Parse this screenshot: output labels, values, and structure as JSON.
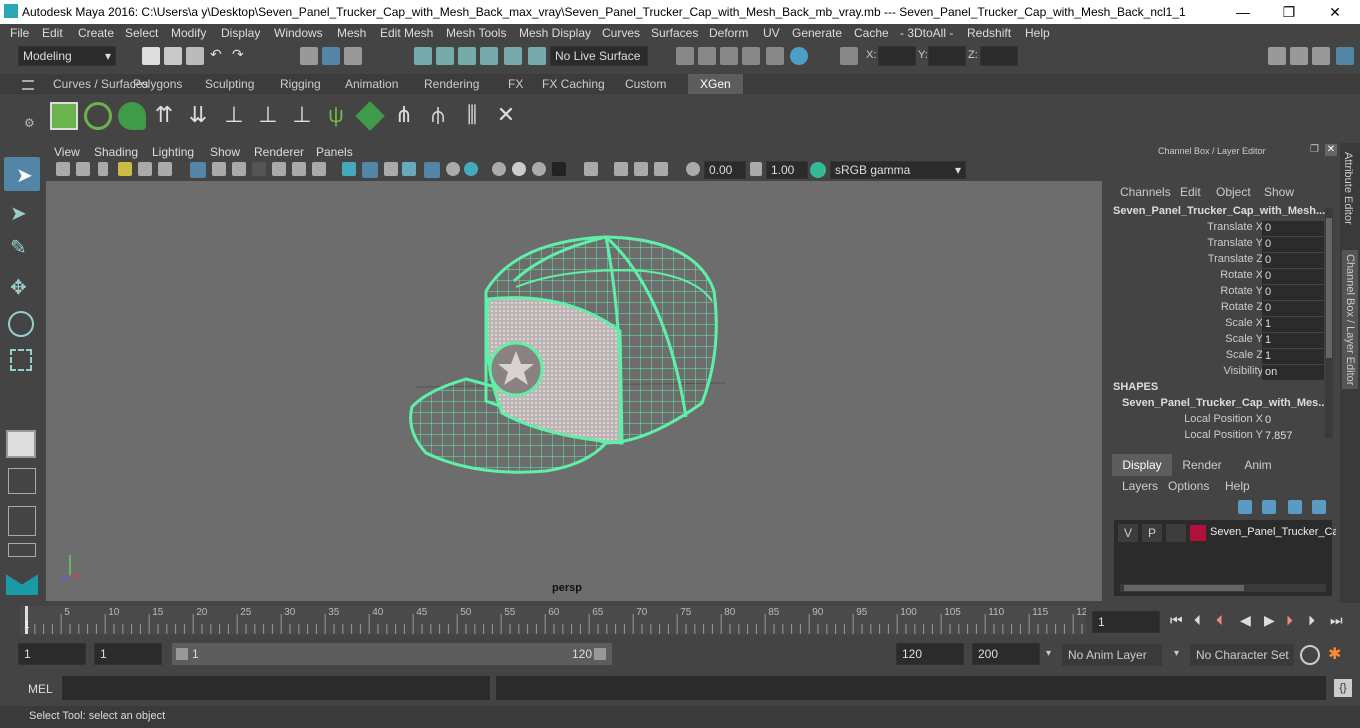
{
  "window": {
    "title": "Autodesk Maya 2016: C:\\Users\\a y\\Desktop\\Seven_Panel_Trucker_Cap_with_Mesh_Back_max_vray\\Seven_Panel_Trucker_Cap_with_Mesh_Back_mb_vray.mb   ---   Seven_Panel_Trucker_Cap_with_Mesh_Back_ncl1_1",
    "min": "—",
    "max": "❐",
    "close": "✕"
  },
  "menu": [
    "File",
    "Edit",
    "Create",
    "Select",
    "Modify",
    "Display",
    "Windows",
    "Mesh",
    "Edit Mesh",
    "Mesh Tools",
    "Mesh Display",
    "Curves",
    "Surfaces",
    "Deform",
    "UV",
    "Generate",
    "Cache",
    "- 3DtoAll -",
    "Redshift",
    "Help"
  ],
  "status": {
    "mode": "Modeling",
    "live_surface": "No Live Surface",
    "x_label": "X:",
    "y_label": "Y:",
    "z_label": "Z:"
  },
  "shelf_tabs": [
    "Curves / Surfaces",
    "Polygons",
    "Sculpting",
    "Rigging",
    "Animation",
    "Rendering",
    "FX",
    "FX Caching",
    "Custom",
    "XGen"
  ],
  "shelf_active": "XGen",
  "viewport": {
    "menu": [
      "View",
      "Shading",
      "Lighting",
      "Show",
      "Renderer",
      "Panels"
    ],
    "exposure": "0.00",
    "gamma": "1.00",
    "colorspace": "sRGB gamma",
    "camera": "persp"
  },
  "channel_box": {
    "header": "Channel Box / Layer Editor",
    "menu": [
      "Channels",
      "Edit",
      "Object",
      "Show"
    ],
    "object": "Seven_Panel_Trucker_Cap_with_Mesh...",
    "channels": [
      {
        "label": "Translate X",
        "value": "0"
      },
      {
        "label": "Translate Y",
        "value": "0"
      },
      {
        "label": "Translate Z",
        "value": "0"
      },
      {
        "label": "Rotate X",
        "value": "0"
      },
      {
        "label": "Rotate Y",
        "value": "0"
      },
      {
        "label": "Rotate Z",
        "value": "0"
      },
      {
        "label": "Scale X",
        "value": "1"
      },
      {
        "label": "Scale Y",
        "value": "1"
      },
      {
        "label": "Scale Z",
        "value": "1"
      },
      {
        "label": "Visibility",
        "value": "on"
      }
    ],
    "shapes_label": "SHAPES",
    "shape_name": "Seven_Panel_Trucker_Cap_with_Mes...",
    "shape_channels": [
      {
        "label": "Local Position X",
        "value": "0"
      },
      {
        "label": "Local Position Y",
        "value": "7.857"
      }
    ]
  },
  "layer_editor": {
    "tabs": [
      "Display",
      "Render",
      "Anim"
    ],
    "menu": [
      "Layers",
      "Options",
      "Help"
    ],
    "layer": {
      "v": "V",
      "p": "P",
      "name": "Seven_Panel_Trucker_Cap",
      "color": "#b0103a"
    }
  },
  "side_tabs": [
    "Attribute Editor",
    "Channel Box / Layer Editor"
  ],
  "timeline": {
    "ticks": [
      "5",
      "10",
      "15",
      "20",
      "25",
      "30",
      "35",
      "40",
      "45",
      "50",
      "55",
      "60",
      "65",
      "70",
      "75",
      "80",
      "85",
      "90",
      "95",
      "100",
      "105",
      "110",
      "115",
      "12"
    ],
    "start_marker": "1",
    "current_frame": "1"
  },
  "range": {
    "start": "1",
    "play_start": "1",
    "slider_start": "1",
    "slider_end": "120",
    "play_end": "120",
    "end": "200",
    "anim_layer": "No Anim Layer",
    "char_set": "No Character Set"
  },
  "mel": {
    "label": "MEL"
  },
  "statusbar": {
    "text": "Select Tool: select an object"
  },
  "colors": {
    "wire": "#5ff0a8",
    "viewport_bg": "#6d6d6d",
    "accent": "#5285a6"
  }
}
